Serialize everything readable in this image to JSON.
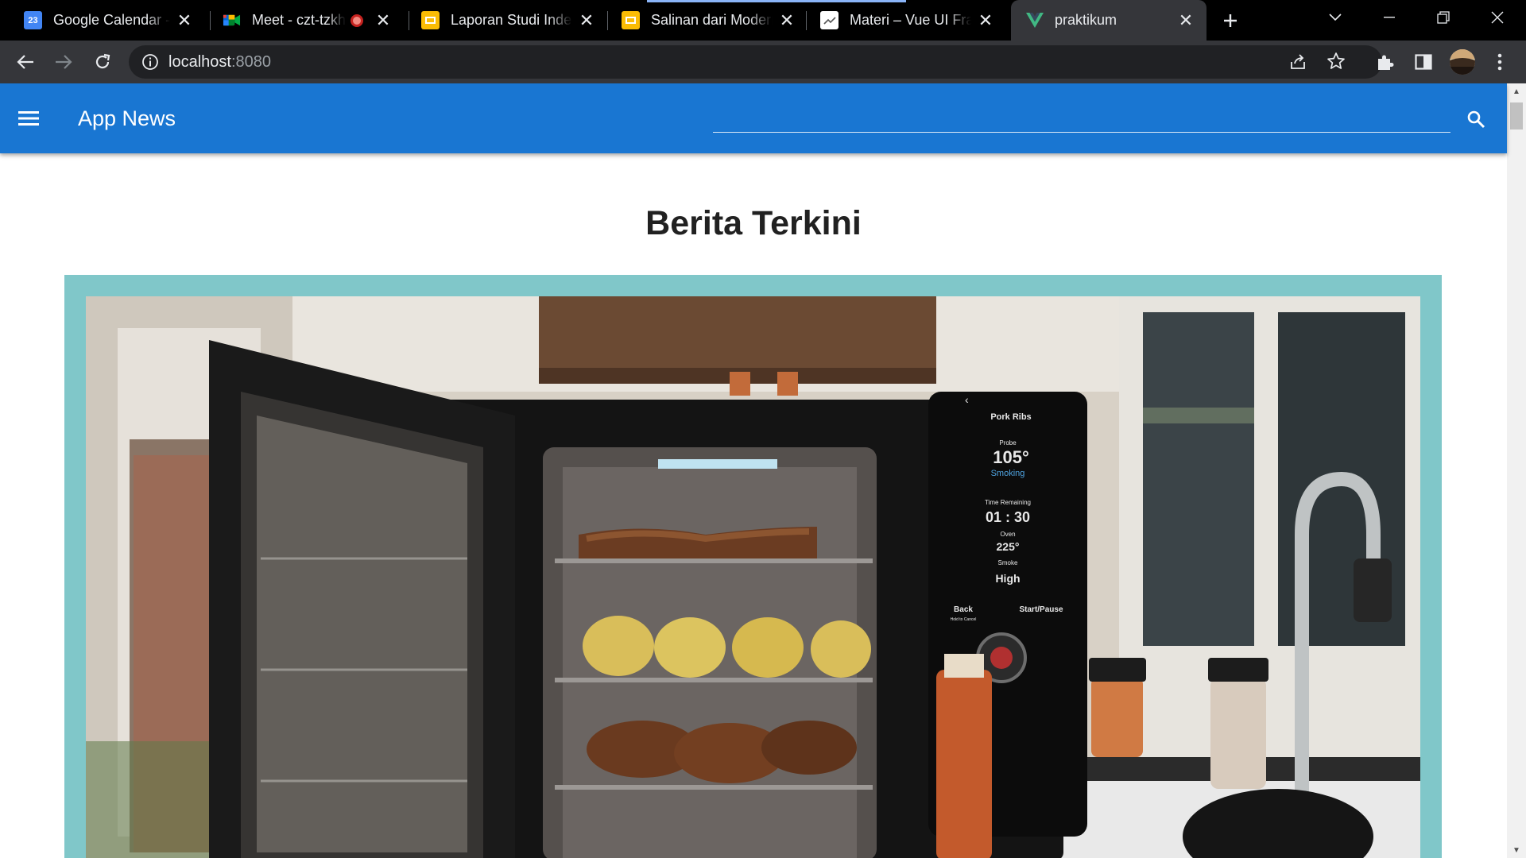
{
  "browser": {
    "tabs": [
      {
        "title": "Google Calendar - W",
        "icon": "google-calendar-icon",
        "icon_text": "23",
        "icon_color": "#4285f4"
      },
      {
        "title": "Meet - czt-tzkh",
        "icon": "google-meet-icon",
        "icon_color": "#00832d",
        "recording": true
      },
      {
        "title": "Laporan Studi Indep",
        "icon": "google-slides-icon",
        "icon_color": "#fbbc04"
      },
      {
        "title": "Salinan dari Modern",
        "icon": "google-slides-icon",
        "icon_color": "#fbbc04"
      },
      {
        "title": "Materi – Vue UI Fra",
        "icon": "document-page-icon",
        "icon_color": "#ffffff"
      },
      {
        "title": "praktikum",
        "icon": "vue-logo-icon",
        "icon_color": "#41b883",
        "active": true
      }
    ],
    "address_bar": {
      "host": "localhost",
      "port": ":8080"
    }
  },
  "app": {
    "title": "App News",
    "search": {
      "value": "",
      "placeholder": ""
    },
    "colors": {
      "appbar": "#1976d2",
      "card_frame": "#80c7c9"
    }
  },
  "main": {
    "heading": "Berita Terkini",
    "featured_image": {
      "alt": "",
      "smoker_display": {
        "program": "Pork Ribs",
        "probe_label": "Probe",
        "probe_value": "105°",
        "probe_status": "Smoking",
        "time_label": "Time Remaining",
        "time_value": "01 : 30",
        "oven_label": "Oven",
        "oven_value": "225°",
        "smoke_label": "Smoke",
        "smoke_value": "High",
        "back_label": "Back",
        "back_hint": "Hold to Cancel",
        "start_label": "Start/Pause"
      }
    }
  }
}
